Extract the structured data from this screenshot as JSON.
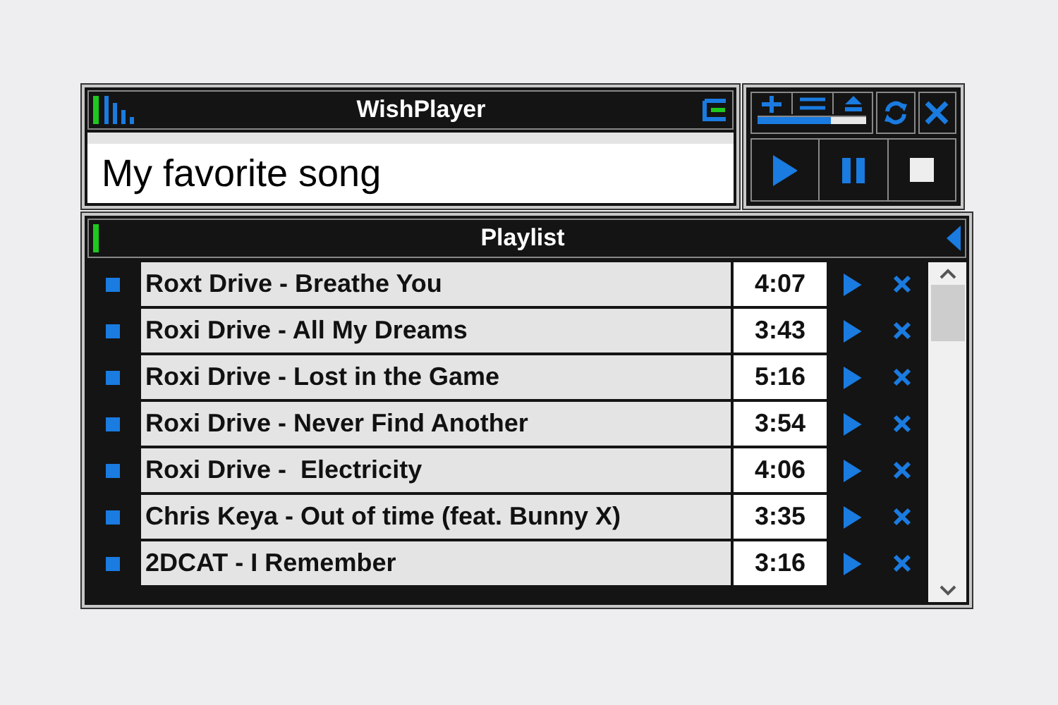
{
  "player": {
    "title": "WishPlayer",
    "now_playing": "My favorite song"
  },
  "controls": {
    "volume": {
      "level": 0.67
    }
  },
  "playlist": {
    "title": "Playlist",
    "tracks": [
      {
        "name": "Roxt Drive - Breathe You",
        "duration": "4:07"
      },
      {
        "name": "Roxi Drive - All My Dreams",
        "duration": "3:43"
      },
      {
        "name": "Roxi Drive - Lost in the Game",
        "duration": "5:16"
      },
      {
        "name": "Roxi Drive - Never Find Another",
        "duration": "3:54"
      },
      {
        "name": "Roxi Drive -  Electricity",
        "duration": "4:06"
      },
      {
        "name": "Chris Keya - Out of time (feat. Bunny X)",
        "duration": "3:35"
      },
      {
        "name": "2DCAT - I Remember",
        "duration": "3:16"
      }
    ]
  }
}
